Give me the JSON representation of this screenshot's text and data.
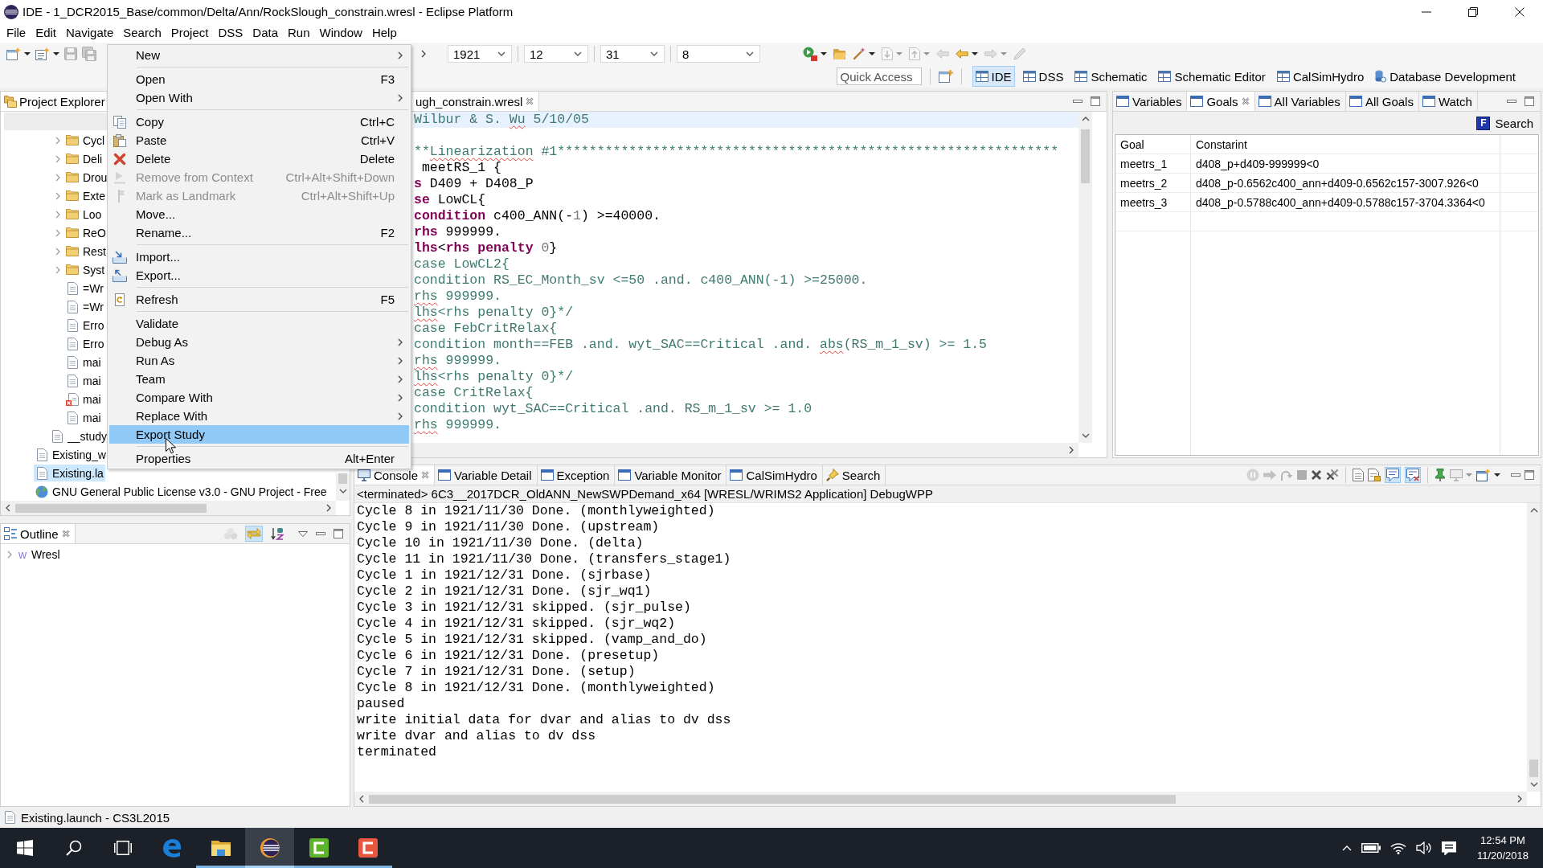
{
  "window": {
    "title": "IDE - 1_DCR2015_Base/common/Delta/Ann/RockSlough_constrain.wresl - Eclipse Platform"
  },
  "menu_bar": [
    "File",
    "Edit",
    "Navigate",
    "Search",
    "Project",
    "DSS",
    "Data",
    "Run",
    "Window",
    "Help"
  ],
  "main_toolbar": [
    {
      "kind": "window-star",
      "dropdown": true,
      "disabled": false
    },
    {
      "kind": "document-star",
      "dropdown": true,
      "disabled": false
    },
    {
      "kind": "floppy",
      "dropdown": false,
      "disabled": true
    },
    {
      "kind": "floppies",
      "dropdown": false,
      "disabled": true
    }
  ],
  "date_selectors": [
    {
      "value": "1921"
    },
    {
      "value": "12"
    },
    {
      "value": "31"
    },
    {
      "value": "8"
    }
  ],
  "launch_toolbar": [
    {
      "kind": "play-stop",
      "dropdown": true,
      "disabled": false
    },
    {
      "kind": "folder",
      "dropdown": false,
      "disabled": false
    },
    {
      "kind": "wand",
      "dropdown": true,
      "disabled": false
    },
    {
      "kind": "page-down",
      "dropdown": true,
      "disabled": true
    },
    {
      "kind": "page-up",
      "dropdown": true,
      "disabled": true
    },
    {
      "kind": "arrow-left",
      "dropdown": false,
      "disabled": true
    },
    {
      "kind": "arrow-left",
      "dropdown": true,
      "disabled": false
    },
    {
      "kind": "arrow-right",
      "dropdown": true,
      "disabled": true
    },
    {
      "kind": "pencil",
      "dropdown": false,
      "disabled": true
    }
  ],
  "quick_access": {
    "placeholder": "Quick Access"
  },
  "perspectives": [
    {
      "label": "IDE",
      "kind": "grid",
      "selected": true
    },
    {
      "label": "DSS",
      "kind": "grid",
      "selected": false
    },
    {
      "label": "Schematic",
      "kind": "grid",
      "selected": false
    },
    {
      "label": "Schematic Editor",
      "kind": "grid",
      "selected": false
    },
    {
      "label": "CalSimHydro",
      "kind": "grid",
      "selected": false
    },
    {
      "label": "Database Development",
      "kind": "database",
      "selected": false
    }
  ],
  "context_menu": [
    {
      "kind": "item",
      "label": "New",
      "submenu": true,
      "disabled": false,
      "selected": false
    },
    {
      "kind": "separator"
    },
    {
      "kind": "item",
      "label": "Open",
      "shortcut": "F3",
      "submenu": false,
      "disabled": false,
      "selected": false
    },
    {
      "kind": "item",
      "label": "Open With",
      "submenu": true,
      "disabled": false,
      "selected": false
    },
    {
      "kind": "separator"
    },
    {
      "kind": "item",
      "label": "Copy",
      "shortcut": "Ctrl+C",
      "submenu": false,
      "disabled": false,
      "selected": false
    },
    {
      "kind": "item",
      "label": "Paste",
      "shortcut": "Ctrl+V",
      "submenu": false,
      "disabled": false,
      "selected": false
    },
    {
      "kind": "item",
      "label": "Delete",
      "shortcut": "Delete",
      "submenu": false,
      "disabled": false,
      "selected": false
    },
    {
      "kind": "item",
      "label": "Remove from Context",
      "shortcut": "Ctrl+Alt+Shift+Down",
      "submenu": false,
      "disabled": true,
      "selected": false
    },
    {
      "kind": "item",
      "label": "Mark as Landmark",
      "shortcut": "Ctrl+Alt+Shift+Up",
      "submenu": false,
      "disabled": true,
      "selected": false
    },
    {
      "kind": "item",
      "label": "Move...",
      "submenu": false,
      "disabled": false,
      "selected": false
    },
    {
      "kind": "item",
      "label": "Rename...",
      "shortcut": "F2",
      "submenu": false,
      "disabled": false,
      "selected": false
    },
    {
      "kind": "separator"
    },
    {
      "kind": "item",
      "label": "Import...",
      "submenu": false,
      "disabled": false,
      "selected": false
    },
    {
      "kind": "item",
      "label": "Export...",
      "submenu": false,
      "disabled": false,
      "selected": false
    },
    {
      "kind": "separator"
    },
    {
      "kind": "item",
      "label": "Refresh",
      "shortcut": "F5",
      "submenu": false,
      "disabled": false,
      "selected": false
    },
    {
      "kind": "separator"
    },
    {
      "kind": "item",
      "label": "Validate",
      "submenu": false,
      "disabled": false,
      "selected": false
    },
    {
      "kind": "item",
      "label": "Debug As",
      "submenu": true,
      "disabled": false,
      "selected": false
    },
    {
      "kind": "item",
      "label": "Run As",
      "submenu": true,
      "disabled": false,
      "selected": false
    },
    {
      "kind": "item",
      "label": "Team",
      "submenu": true,
      "disabled": false,
      "selected": false
    },
    {
      "kind": "item",
      "label": "Compare With",
      "submenu": true,
      "disabled": false,
      "selected": false
    },
    {
      "kind": "item",
      "label": "Replace With",
      "submenu": true,
      "disabled": false,
      "selected": false
    },
    {
      "kind": "item",
      "label": "Export Study",
      "submenu": false,
      "disabled": false,
      "selected": true
    },
    {
      "kind": "separator"
    },
    {
      "kind": "item",
      "label": "Properties",
      "shortcut": "Alt+Enter",
      "submenu": false,
      "disabled": false,
      "selected": false
    }
  ],
  "project_explorer": {
    "title": "Project Explorer",
    "closable": false,
    "tree": [
      {
        "children": [
          {
            "children": [
              {
                "label": "Cycl",
                "kind": "folder",
                "expanded": false,
                "selected": false
              },
              {
                "label": "Deli",
                "kind": "folder",
                "expanded": false,
                "selected": false
              },
              {
                "label": "Drou",
                "kind": "folder",
                "expanded": false,
                "selected": false
              },
              {
                "label": "Exte",
                "kind": "folder",
                "expanded": false,
                "selected": false
              },
              {
                "label": "Loo",
                "kind": "folder",
                "expanded": false,
                "selected": false
              },
              {
                "label": "ReO",
                "kind": "folder",
                "expanded": false,
                "selected": false
              },
              {
                "label": "Rest",
                "kind": "folder",
                "expanded": false,
                "selected": false
              },
              {
                "label": "Syst",
                "kind": "folder",
                "expanded": false,
                "selected": false
              },
              {
                "label": "=Wr",
                "kind": "file",
                "selected": false
              },
              {
                "label": "=Wr",
                "kind": "file",
                "selected": false
              },
              {
                "label": "Erro",
                "kind": "file",
                "selected": false
              },
              {
                "label": "Erro",
                "kind": "file",
                "selected": false
              },
              {
                "label": "mai",
                "kind": "file",
                "selected": false
              },
              {
                "label": "mai",
                "kind": "file",
                "selected": false
              },
              {
                "label": "mai",
                "kind": "error-file",
                "selected": false
              },
              {
                "label": "mai",
                "kind": "file",
                "selected": false
              }
            ]
          },
          {
            "label": "__study",
            "kind": "file",
            "selected": false
          }
        ]
      },
      {
        "label": "Existing_w",
        "kind": "file",
        "selected": false
      },
      {
        "label": "Existing.la",
        "kind": "file",
        "selected": true
      },
      {
        "label": "GNU General Public License v3.0 - GNU Project - Free",
        "kind": "link",
        "selected": false
      }
    ]
  },
  "editor": {
    "tab": {
      "label": "ugh_constrain.wresl",
      "selected": true,
      "closable": true
    },
    "lines": [
      {
        "current": true,
        "segments": [
          {
            "text": "Wilbur & S. ",
            "kind": "comment"
          },
          {
            "text": "Wu",
            "kind": "misspelled"
          },
          {
            "text": " 5/10/05",
            "kind": "comment"
          }
        ]
      },
      {
        "current": false
      },
      {
        "current": false,
        "segments": [
          {
            "text": "**",
            "kind": "comment"
          },
          {
            "text": "Linearization",
            "kind": "misspelled"
          },
          {
            "text": " #1***************************************************************",
            "kind": "comment"
          }
        ]
      },
      {
        "current": false,
        "segments": [
          {
            "text": " meetRS_1 {",
            "kind": "plain"
          }
        ]
      },
      {
        "current": false,
        "segments": [
          {
            "text": "s",
            "kind": "keyword"
          },
          {
            "text": " D409 + D408_P",
            "kind": "plain"
          }
        ]
      },
      {
        "current": false,
        "segments": [
          {
            "text": "se",
            "kind": "keyword"
          },
          {
            "text": " LowCL{",
            "kind": "plain"
          }
        ]
      },
      {
        "current": false,
        "segments": [
          {
            "text": "condition",
            "kind": "keyword"
          },
          {
            "text": " c400_ANN(-",
            "kind": "plain"
          },
          {
            "text": "1",
            "kind": "number"
          },
          {
            "text": ") >=40000.",
            "kind": "plain"
          }
        ]
      },
      {
        "current": false,
        "segments": [
          {
            "text": "rhs",
            "kind": "keyword"
          },
          {
            "text": " 999999.",
            "kind": "plain"
          }
        ]
      },
      {
        "current": false,
        "segments": [
          {
            "text": "lhs",
            "kind": "keyword"
          },
          {
            "text": "<",
            "kind": "plain"
          },
          {
            "text": "rhs penalty",
            "kind": "keyword"
          },
          {
            "text": " 0",
            "kind": "number"
          },
          {
            "text": "}",
            "kind": "plain"
          }
        ]
      },
      {
        "current": false,
        "segments": [
          {
            "text": "case LowCL2{",
            "kind": "comment"
          }
        ]
      },
      {
        "current": false,
        "segments": [
          {
            "text": "condition RS_EC_Month_sv <=50 .and. c400_ANN(-1) >=25000.",
            "kind": "comment"
          }
        ]
      },
      {
        "current": false,
        "segments": [
          {
            "text": "rhs",
            "kind": "misspelled"
          },
          {
            "text": " 999999.",
            "kind": "comment"
          }
        ]
      },
      {
        "current": false,
        "segments": [
          {
            "text": "lhs",
            "kind": "misspelled"
          },
          {
            "text": "<rhs penalty 0}*/",
            "kind": "comment"
          }
        ]
      },
      {
        "current": false,
        "segments": [
          {
            "text": "case FebCritRelax{",
            "kind": "comment"
          }
        ]
      },
      {
        "current": false,
        "segments": [
          {
            "text": "condition month==FEB .and. wyt_SAC==Critical .and. ",
            "kind": "comment"
          },
          {
            "text": "abs",
            "kind": "misspelled"
          },
          {
            "text": "(RS_m_1_sv) >= 1.5",
            "kind": "comment"
          }
        ]
      },
      {
        "current": false,
        "segments": [
          {
            "text": "rhs",
            "kind": "misspelled"
          },
          {
            "text": " 999999.",
            "kind": "comment"
          }
        ]
      },
      {
        "current": false,
        "segments": [
          {
            "text": "lhs",
            "kind": "misspelled"
          },
          {
            "text": "<rhs penalty 0}*/",
            "kind": "comment"
          }
        ]
      },
      {
        "current": false,
        "segments": [
          {
            "text": "case CritRelax{",
            "kind": "comment"
          }
        ]
      },
      {
        "current": false,
        "segments": [
          {
            "text": "condition wyt_SAC==Critical .and. RS_m_1_sv >= 1.0",
            "kind": "comment"
          }
        ]
      },
      {
        "current": false,
        "segments": [
          {
            "text": "rhs",
            "kind": "misspelled"
          },
          {
            "text": " 999999.",
            "kind": "comment"
          }
        ]
      }
    ]
  },
  "goals_view": {
    "tabs": [
      {
        "label": "Variables",
        "selected": false
      },
      {
        "label": "Goals",
        "selected": true
      },
      {
        "label": "All Variables",
        "selected": false
      },
      {
        "label": "All Goals",
        "selected": false
      },
      {
        "label": "Watch",
        "selected": false
      }
    ],
    "search_button": {
      "icon_text": "F",
      "label": "Search"
    },
    "table": {
      "columns": [
        "Goal",
        "Constarint"
      ],
      "rows": [
        [
          "meetrs_1",
          "d408_p+d409-999999<0"
        ],
        [
          "meetrs_2",
          "d408_p-0.6562c400_ann+d409-0.6562c157-3007.926<0"
        ],
        [
          "meetrs_3",
          "d408_p-0.5788c400_ann+d409-0.5788c157-3704.3364<0"
        ]
      ]
    }
  },
  "outline_view": {
    "title": "Outline",
    "closable": true,
    "toolbar": [
      {
        "kind": "dots",
        "disabled": true,
        "on": false
      },
      {
        "kind": "double-arrow",
        "disabled": false,
        "on": true
      },
      {
        "kind": "sort",
        "disabled": false,
        "on": false
      }
    ],
    "tree": [
      {
        "icon_text": "w",
        "label": "Wresl",
        "expanded": false,
        "selected": false
      }
    ]
  },
  "console_view": {
    "tabs": [
      {
        "label": "Console",
        "kind": "console",
        "selected": true
      },
      {
        "label": "Variable Detail",
        "kind": "view",
        "selected": false
      },
      {
        "label": "Exception",
        "kind": "view",
        "selected": false
      },
      {
        "label": "Variable Monitor",
        "kind": "view",
        "selected": false
      },
      {
        "label": "CalSimHydro",
        "kind": "view",
        "selected": false
      },
      {
        "label": "Search",
        "kind": "search",
        "selected": false
      }
    ],
    "toolbar": [
      {
        "kind": "pause",
        "dropdown": false,
        "disabled": true,
        "on": false
      },
      {
        "kind": "arrow-step",
        "dropdown": false,
        "disabled": true,
        "on": false
      },
      {
        "kind": "curved-arrow",
        "dropdown": false,
        "disabled": true,
        "on": false
      },
      {
        "kind": "stop",
        "dropdown": false,
        "disabled": true,
        "on": false
      },
      {
        "kind": "cross",
        "dropdown": false,
        "disabled": false,
        "on": false
      },
      {
        "kind": "double-cross",
        "dropdown": false,
        "disabled": false,
        "on": false
      },
      {
        "kind": "separator"
      },
      {
        "kind": "page",
        "dropdown": false,
        "disabled": false,
        "on": false
      },
      {
        "kind": "page-lock",
        "dropdown": false,
        "disabled": false,
        "on": false
      },
      {
        "kind": "bubble",
        "dropdown": false,
        "disabled": false,
        "on": true
      },
      {
        "kind": "bubble-cross",
        "dropdown": false,
        "disabled": false,
        "on": true
      },
      {
        "kind": "separator"
      },
      {
        "kind": "pin",
        "dropdown": false,
        "disabled": false,
        "on": false
      },
      {
        "kind": "monitor",
        "dropdown": true,
        "disabled": true,
        "on": false
      },
      {
        "kind": "monitor-plus",
        "dropdown": true,
        "disabled": false,
        "on": false
      }
    ],
    "process": "<terminated> 6C3__2017DCR_OldANN_NewSWPDemand_x64 [WRESL/WRIMS2 Application] DebugWPP",
    "lines": [
      "Cycle 8 in 1921/11/30 Done. (monthlyweighted)",
      "Cycle 9 in 1921/11/30 Done. (upstream)",
      "Cycle 10 in 1921/11/30 Done. (delta)",
      "Cycle 11 in 1921/11/30 Done. (transfers_stage1)",
      "Cycle 1 in 1921/12/31 Done. (sjrbase)",
      "Cycle 2 in 1921/12/31 Done. (sjr_wq1)",
      "Cycle 3 in 1921/12/31 skipped. (sjr_pulse)",
      "Cycle 4 in 1921/12/31 skipped. (sjr_wq2)",
      "Cycle 5 in 1921/12/31 skipped. (vamp_and_do)",
      "Cycle 6 in 1921/12/31 Done. (presetup)",
      "Cycle 7 in 1921/12/31 Done. (setup)",
      "Cycle 8 in 1921/12/31 Done. (monthlyweighted)",
      "paused",
      "write initial data for dvar and alias to dv dss",
      "write dvar and alias to dv dss",
      "terminated"
    ]
  },
  "status_bar": {
    "text": "Existing.launch - CS3L2015"
  },
  "taskbar": {
    "apps": [
      {
        "kind": "letter-e",
        "open": false,
        "active": false
      },
      {
        "kind": "folder",
        "open": true,
        "active": false
      },
      {
        "kind": "striped-ring",
        "open": true,
        "active": true
      },
      {
        "kind": "green-tile",
        "open": true,
        "active": false
      },
      {
        "kind": "orange-tile",
        "open": true,
        "active": false
      }
    ],
    "time": "12:54 PM",
    "date": "11/20/2018"
  }
}
